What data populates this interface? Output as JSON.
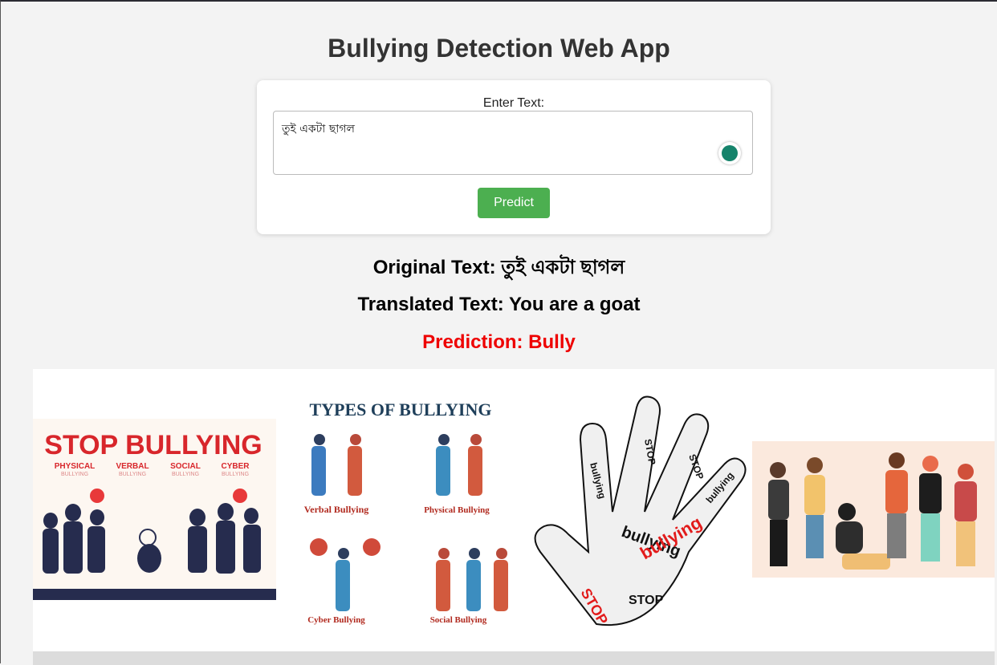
{
  "app": {
    "title": "Bullying Detection Web App"
  },
  "form": {
    "label": "Enter Text:",
    "input_value": "তুই একটা ছাগল",
    "button_label": "Predict"
  },
  "results": {
    "original": "Original Text: তুই একটা ছাগল",
    "translated": "Translated Text: You are a goat",
    "prediction": "Prediction: Bully"
  },
  "images": {
    "stop_bullying": {
      "heading": "STOP BULLYING",
      "cats": [
        "PHYSICAL",
        "VERBAL",
        "SOCIAL",
        "CYBER"
      ],
      "sub": "BULLYING"
    },
    "types": {
      "heading": "TYPES OF BULLYING",
      "labels": [
        "Verbal Bullying",
        "Physical Bullying",
        "Cyber Bullying",
        "Social Bullying"
      ]
    },
    "hand": {
      "word_stop": "STOP",
      "word_bullying": "bullying"
    }
  },
  "colors": {
    "accent_green": "#4caf50",
    "prediction_red": "#ee0000"
  }
}
